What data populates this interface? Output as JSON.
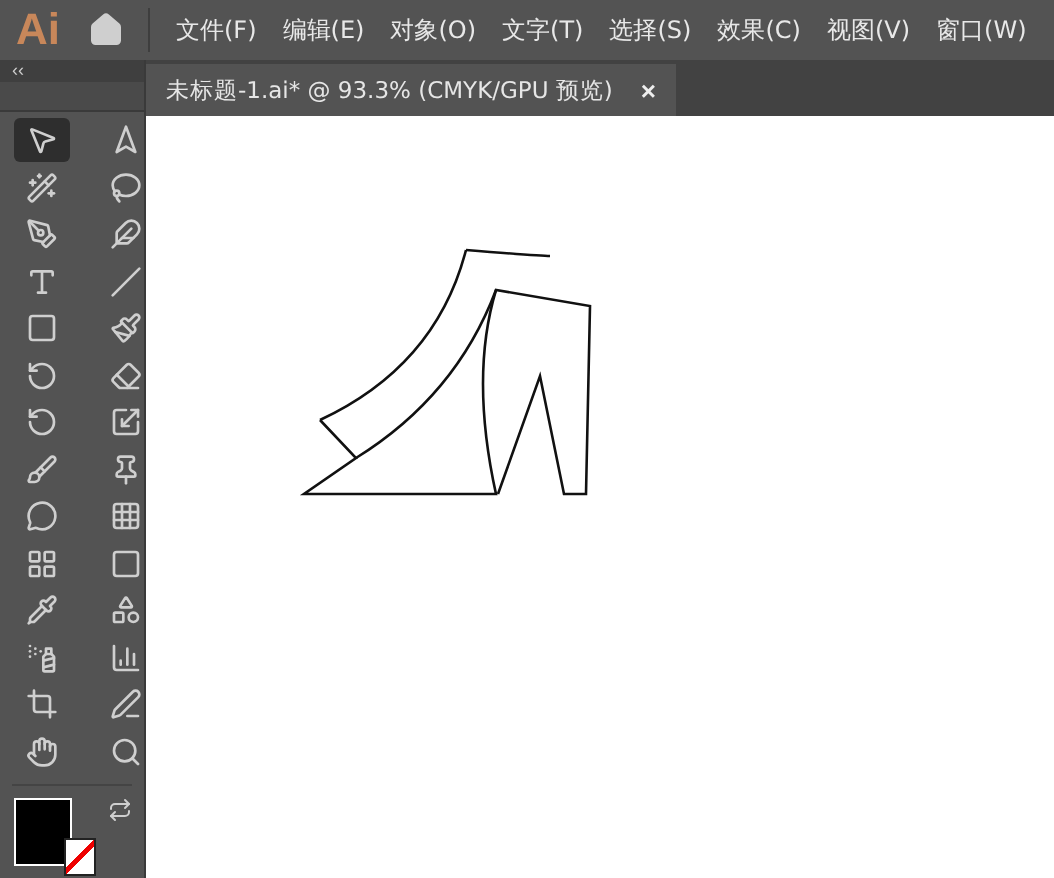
{
  "app": {
    "logo": "Ai"
  },
  "menu": [
    {
      "label": "文件(F)"
    },
    {
      "label": "编辑(E)"
    },
    {
      "label": "对象(O)"
    },
    {
      "label": "文字(T)"
    },
    {
      "label": "选择(S)"
    },
    {
      "label": "效果(C)"
    },
    {
      "label": "视图(V)"
    },
    {
      "label": "窗口(W)"
    }
  ],
  "collapse_toggle": "‹‹",
  "document_tab": {
    "title": "未标题-1.ai* @ 93.3% (CMYK/GPU 预览)",
    "close": "×",
    "selected": true
  },
  "tools": [
    {
      "selected": true
    },
    {
      "selected": false
    },
    {
      "selected": false
    },
    {
      "selected": false
    },
    {
      "selected": false
    },
    {
      "selected": false
    },
    {
      "selected": false
    },
    {
      "selected": false
    },
    {
      "selected": false
    },
    {
      "selected": false
    },
    {
      "selected": false
    },
    {
      "selected": false
    },
    {
      "selected": false
    },
    {
      "selected": false
    },
    {
      "selected": false
    },
    {
      "selected": false
    },
    {
      "selected": false
    },
    {
      "selected": false
    },
    {
      "selected": false
    },
    {
      "selected": false
    },
    {
      "selected": false
    },
    {
      "selected": false
    },
    {
      "selected": false
    },
    {
      "selected": false
    },
    {
      "selected": false
    },
    {
      "selected": false
    },
    {
      "selected": false
    },
    {
      "selected": false
    }
  ]
}
